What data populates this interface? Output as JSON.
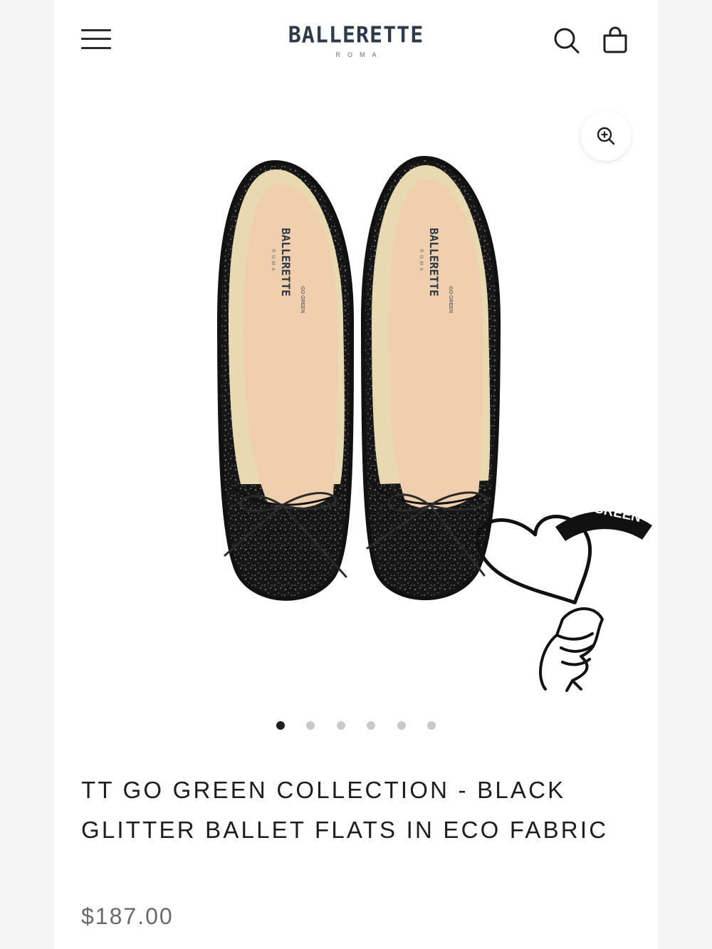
{
  "header": {
    "brand": "BALLERETTE",
    "brand_sub": "ROMA",
    "menu_icon": "hamburger-icon",
    "search_icon": "search-icon",
    "cart_icon": "shopping-bag-icon"
  },
  "gallery": {
    "zoom_icon": "zoom-in-icon",
    "image_alt": "Black glitter ballet flats with bow",
    "insole_brand": "BALLERETTE",
    "insole_sub": "ROMA",
    "insole_badge": "GO GREEN",
    "badge_text": "GO GREEN",
    "slide_count": 6,
    "active_slide": 1
  },
  "product": {
    "title": "TT GO GREEN COLLECTION - BLACK GLITTER BALLET FLATS IN ECO FABRIC",
    "price": "$187.00"
  },
  "colors": {
    "logo": "#2e3a48",
    "text": "#1d1d1d",
    "price": "#6a6a6a",
    "dot_active": "#1e1e1e",
    "dot_inactive": "#c9c9c9"
  }
}
